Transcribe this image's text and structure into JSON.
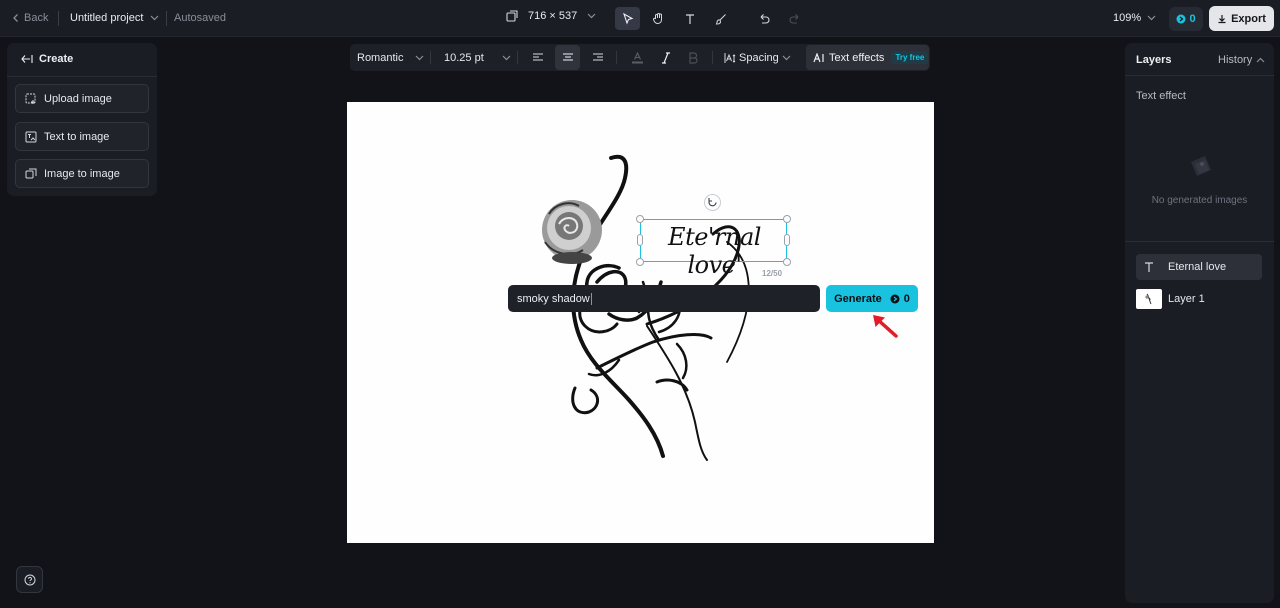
{
  "topbar": {
    "back_label": "Back",
    "project_title": "Untitled project",
    "save_status": "Autosaved",
    "canvas_size": "716 × 537",
    "zoom": "109%",
    "credits": "0",
    "export_label": "Export"
  },
  "left_panel": {
    "header": "Create",
    "buttons": [
      {
        "label": "Upload image",
        "icon": "upload-image-icon"
      },
      {
        "label": "Text to image",
        "icon": "text-to-image-icon"
      },
      {
        "label": "Image to image",
        "icon": "image-to-image-icon"
      }
    ]
  },
  "text_toolbar": {
    "font": "Romantic",
    "font_size": "10.25 pt",
    "spacing_label": "Spacing",
    "effects_label": "Text effects",
    "effects_badge": "Try free"
  },
  "canvas": {
    "text_layer": "Ete'rnal love'",
    "char_count": "12/50",
    "prompt_value": "smoky shadow",
    "generate_label": "Generate",
    "generate_cost": "0"
  },
  "right_panel": {
    "tab_layers": "Layers",
    "tab_history": "History",
    "section_title": "Text effect",
    "empty_text": "No generated images",
    "layers": [
      {
        "label": "Eternal love",
        "type": "text"
      },
      {
        "label": "Layer 1",
        "type": "image"
      }
    ]
  },
  "colors": {
    "accent": "#19c3e0",
    "background": "#111319",
    "panel": "#1b1d24",
    "annotation_arrow": "#e11d2a"
  }
}
